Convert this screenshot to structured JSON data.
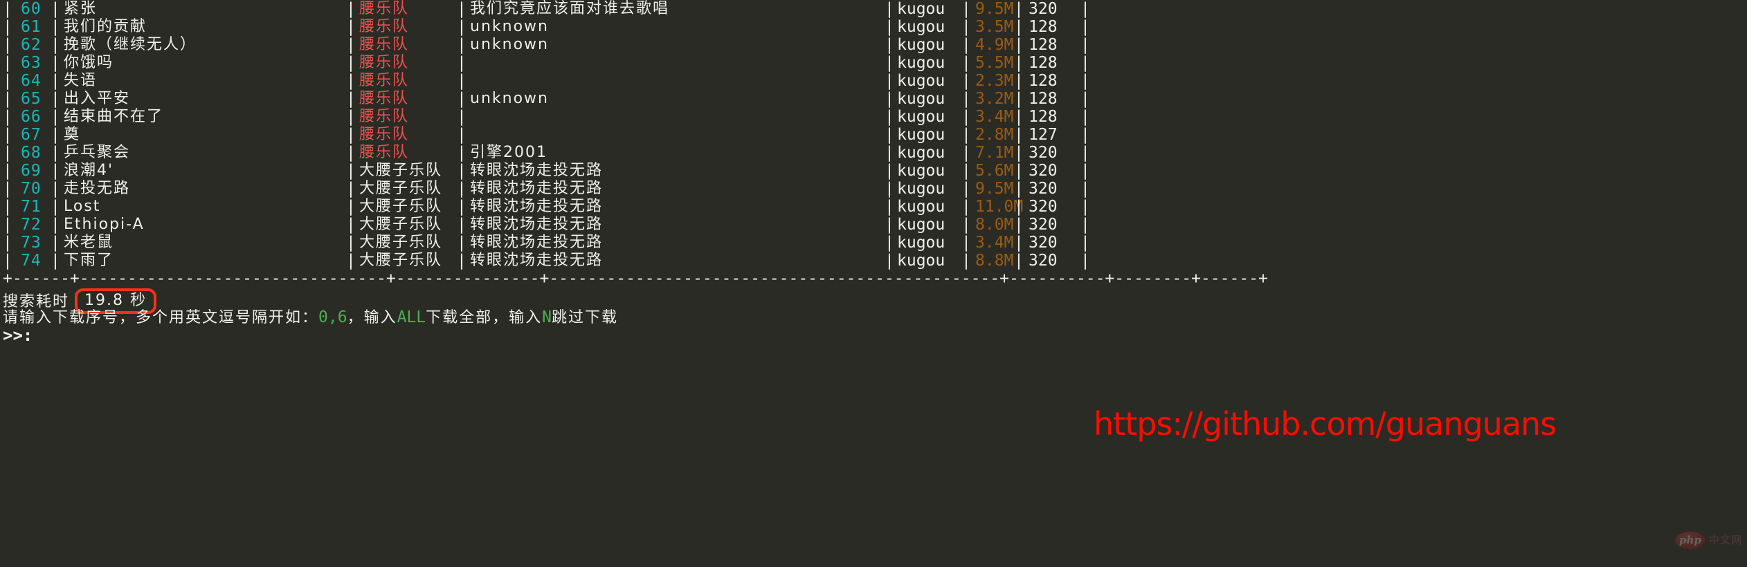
{
  "terminal": {
    "background": "#2b2b26",
    "foreground": "#f0f0ea",
    "index_color": "#19b6b6",
    "artist_red": "#ef5350",
    "size_color": "#9a5b12",
    "green": "#4caf50",
    "highlight_border": "#f4321a"
  },
  "table": {
    "column_sep": "|",
    "separator_line": "+------+--------------------------------+---------------+-----------------------------------------------+----------+--------+------+",
    "rows": [
      {
        "index": "60",
        "title": "紧张",
        "artist": "腰乐队",
        "artist_red": true,
        "album": "我们究竟应该面对谁去歌唱",
        "source": "kugou",
        "size": "9.5M",
        "rate": "320"
      },
      {
        "index": "61",
        "title": "我们的贡献",
        "artist": "腰乐队",
        "artist_red": true,
        "album": "unknown",
        "source": "kugou",
        "size": "3.5M",
        "rate": "128"
      },
      {
        "index": "62",
        "title": "挽歌（继续无人）",
        "artist": "腰乐队",
        "artist_red": true,
        "album": "unknown",
        "source": "kugou",
        "size": "4.9M",
        "rate": "128"
      },
      {
        "index": "63",
        "title": "你饿吗",
        "artist": "腰乐队",
        "artist_red": true,
        "album": "",
        "source": "kugou",
        "size": "5.5M",
        "rate": "128"
      },
      {
        "index": "64",
        "title": "失语",
        "artist": "腰乐队",
        "artist_red": true,
        "album": "",
        "source": "kugou",
        "size": "2.3M",
        "rate": "128"
      },
      {
        "index": "65",
        "title": "出入平安",
        "artist": "腰乐队",
        "artist_red": true,
        "album": "unknown",
        "source": "kugou",
        "size": "3.2M",
        "rate": "128"
      },
      {
        "index": "66",
        "title": "结束曲不在了",
        "artist": "腰乐队",
        "artist_red": true,
        "album": "",
        "source": "kugou",
        "size": "3.4M",
        "rate": "128"
      },
      {
        "index": "67",
        "title": "奠",
        "artist": "腰乐队",
        "artist_red": true,
        "album": "",
        "source": "kugou",
        "size": "2.8M",
        "rate": "127"
      },
      {
        "index": "68",
        "title": "乒乓聚会",
        "artist": "腰乐队",
        "artist_red": true,
        "album": "引擎2001",
        "source": "kugou",
        "size": "7.1M",
        "rate": "320"
      },
      {
        "index": "69",
        "title": "浪潮4'",
        "artist": "大腰子乐队",
        "artist_red": false,
        "album": "转眼沈场走投无路",
        "source": "kugou",
        "size": "5.6M",
        "rate": "320"
      },
      {
        "index": "70",
        "title": "走投无路",
        "artist": "大腰子乐队",
        "artist_red": false,
        "album": "转眼沈场走投无路",
        "source": "kugou",
        "size": "9.5M",
        "rate": "320"
      },
      {
        "index": "71",
        "title": "Lost",
        "artist": "大腰子乐队",
        "artist_red": false,
        "album": "转眼沈场走投无路",
        "source": "kugou",
        "size": "11.0M",
        "rate": "320"
      },
      {
        "index": "72",
        "title": "Ethiopi-A",
        "artist": "大腰子乐队",
        "artist_red": false,
        "album": "转眼沈场走投无路",
        "source": "kugou",
        "size": "8.0M",
        "rate": "320"
      },
      {
        "index": "73",
        "title": "米老鼠",
        "artist": "大腰子乐队",
        "artist_red": false,
        "album": "转眼沈场走投无路",
        "source": "kugou",
        "size": "3.4M",
        "rate": "320"
      },
      {
        "index": "74",
        "title": "下雨了",
        "artist": "大腰子乐队",
        "artist_red": false,
        "album": "转眼沈场走投无路",
        "source": "kugou",
        "size": "8.8M",
        "rate": "320"
      }
    ]
  },
  "footer": {
    "elapsed_label": "搜索耗时",
    "elapsed_value": "19.8 秒",
    "hint_part1": "请输入下载序号，多个用英文逗号隔开如：",
    "hint_example": "0,6",
    "hint_part2": "，输入",
    "hint_all": "ALL",
    "hint_part3": "下载全部，输入",
    "hint_skip": "N",
    "hint_part4": "跳过下载",
    "prompt": ">>:"
  },
  "watermarks": {
    "github": "https://github.com/guanguans",
    "php_logo": "php",
    "php_text": "中文网"
  }
}
